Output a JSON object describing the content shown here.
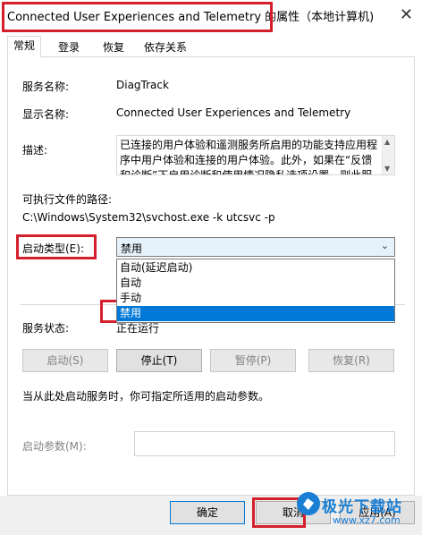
{
  "window": {
    "title": "Connected User Experiences and Telemetry 的属性（本地计算机)",
    "close_glyph": "✕"
  },
  "tabs": [
    {
      "label": "常规",
      "active": true
    },
    {
      "label": "登录",
      "active": false
    },
    {
      "label": "恢复",
      "active": false
    },
    {
      "label": "依存关系",
      "active": false
    }
  ],
  "general": {
    "service_name_label": "服务名称:",
    "service_name": "DiagTrack",
    "display_name_label": "显示名称:",
    "display_name": "Connected User Experiences and Telemetry",
    "description_label": "描述:",
    "description": "已连接的用户体验和遥测服务所启用的功能支持应用程序中用户体验和连接的用户体验。此外，如果在“反馈和诊断”下启用诊断和使用情况隐私选项设置，则此服",
    "exe_path_label": "可执行文件的路径:",
    "exe_path": "C:\\Windows\\System32\\svchost.exe -k utcsvc -p",
    "startup_type_label": "启动类型(E):",
    "startup_type_value": "禁用",
    "startup_options": [
      "自动(延迟启动)",
      "自动",
      "手动",
      "禁用"
    ],
    "startup_selected_index": 3,
    "status_label": "服务状态:",
    "status_value": "正在运行",
    "btn_start": "启动(S)",
    "btn_stop": "停止(T)",
    "btn_pause": "暂停(P)",
    "btn_resume": "恢复(R)",
    "hint": "当从此处启动服务时，你可指定所适用的启动参数。",
    "params_label": "启动参数(M):",
    "params_value": ""
  },
  "footer": {
    "ok": "确定",
    "cancel": "取消",
    "apply": "应用(A)"
  },
  "watermark": {
    "brand": "极光下载站",
    "url": "www.xz7.com"
  },
  "colors": {
    "highlight_red": "#d4202c",
    "selection_blue": "#0078d7",
    "select_bg": "#e5f1fb"
  },
  "icons": {
    "close": "close-icon",
    "dropdown": "chevron-down-icon",
    "scroll_up": "scroll-up-icon",
    "scroll_down": "scroll-down-icon"
  }
}
